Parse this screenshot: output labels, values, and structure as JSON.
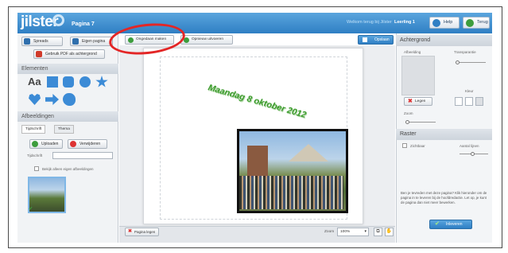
{
  "header": {
    "logo": "jilster",
    "page_title": "Pagina 7",
    "welcome": "Welkom terug bij Jilster",
    "user": "Leerling 1",
    "help_label": "Help",
    "back_label": "Terug"
  },
  "left": {
    "spreads_label": "Spreads",
    "own_pages_label": "Eigen pagina",
    "pdf_label": "Gebruik PDF als achtergrond",
    "elements_title": "Elementen",
    "text_tool_label": "Aa",
    "images_title": "Afbeeldingen",
    "tabs": [
      "Tijdschrift",
      "Thema"
    ],
    "upload_label": "Uploaden",
    "delete_label": "Verwijderen",
    "magazine_label": "Tijdschrift",
    "own_images_only": "Bekijk alleen eigen afbeeldingen"
  },
  "toolbar": {
    "undo_label": "Ongedaan maken",
    "redo_label": "Opnieuw uitvoeren",
    "save_label": "Opslaan"
  },
  "canvas": {
    "headline": "Maandag 8 oktober 2012"
  },
  "bottom": {
    "delete_page_label": "Pagina legen",
    "zoom_label": "Zoom",
    "zoom_value": "100%"
  },
  "right": {
    "background_title": "Achtergrond",
    "image_label": "Afbeelding",
    "transparency_label": "Transparantie",
    "color_label": "Kleur",
    "clear_label": "Legen",
    "zoom_label": "Zoom",
    "grid_title": "Raster",
    "visible_label": "Zichtbaar",
    "grid_lines_label": "Aantal lijnen",
    "help_text": "Ben je tevreden met deze pagina? Klik hieronder om de pagina in te leveren bij de hoofdredactie. Let op, je kunt de pagina dan niet meer bewerken.",
    "submit_label": "Inleveren"
  },
  "colors": {
    "header_blue": "#2f7fc4",
    "headline_green": "#3a9a2a",
    "highlight_red": "#e32626"
  }
}
